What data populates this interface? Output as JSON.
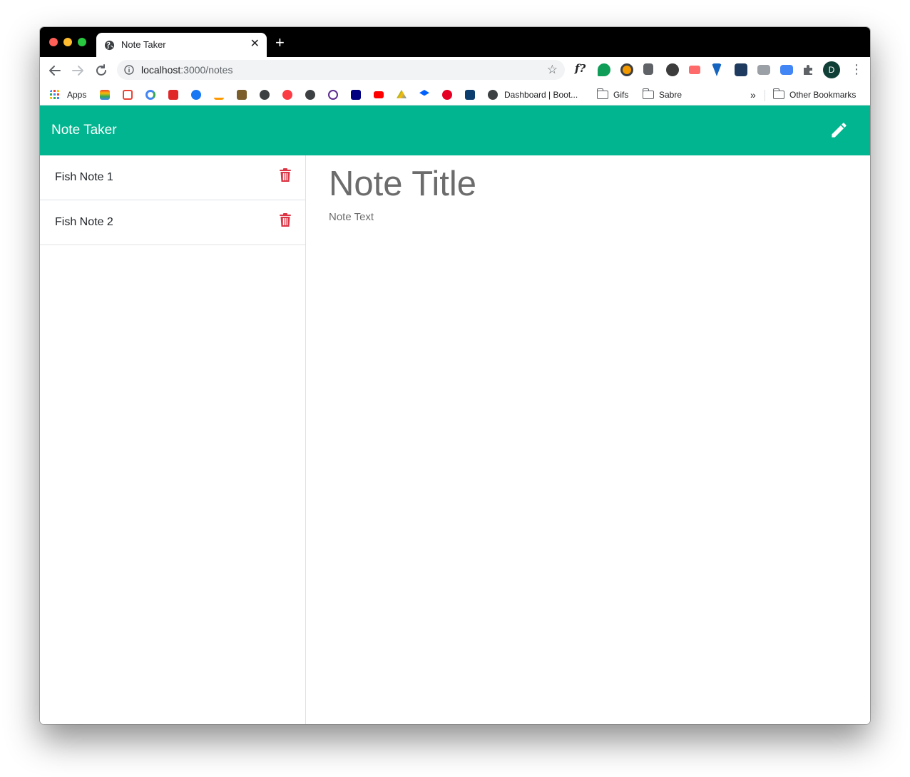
{
  "browser": {
    "tab_title": "Note Taker",
    "tab_close_glyph": "✕",
    "new_tab_glyph": "+",
    "url_host": "localhost",
    "url_path": ":3000/notes",
    "avatar_letter": "D",
    "ext_text": "f?",
    "bookmarks": {
      "apps": "Apps",
      "dashboard": "Dashboard | Boot...",
      "gifs": "Gifs",
      "sabre": "Sabre",
      "overflow": "»",
      "other": "Other Bookmarks"
    }
  },
  "app": {
    "brand": "Note Taker",
    "notes": [
      {
        "title": "Fish Note 1"
      },
      {
        "title": "Fish Note 2"
      }
    ],
    "editor": {
      "title_placeholder": "Note Title",
      "text_placeholder": "Note Text"
    }
  },
  "colors": {
    "navbar": "#00b58f",
    "trash": "#dc3545",
    "placeholder": "#6c6c6c"
  }
}
